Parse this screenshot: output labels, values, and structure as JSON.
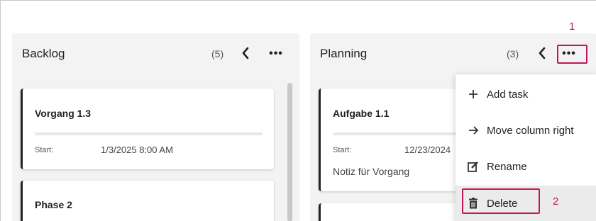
{
  "columns": [
    {
      "title": "Backlog",
      "count": "(5)",
      "cards": [
        {
          "title": "Vorgang 1.3",
          "start_label": "Start:",
          "start_value": "1/3/2025 8:00 AM"
        },
        {
          "title": "Phase 2"
        }
      ]
    },
    {
      "title": "Planning",
      "count": "(3)",
      "cards": [
        {
          "title": "Aufgabe 1.1",
          "start_label": "Start:",
          "start_value": "12/23/2024",
          "note": "Notiz für Vorgang"
        }
      ]
    }
  ],
  "context_menu": {
    "items": [
      {
        "label": "Add task",
        "icon": "plus-icon"
      },
      {
        "label": "Move column right",
        "icon": "arrow-right-icon"
      },
      {
        "label": "Rename",
        "icon": "edit-icon"
      },
      {
        "label": "Delete",
        "icon": "trash-icon"
      }
    ]
  },
  "callouts": {
    "step1": "1",
    "step2": "2"
  },
  "colors": {
    "highlight": "#c2185b",
    "column_bg": "#f3f3f3",
    "menu_hover": "#ebebeb"
  }
}
